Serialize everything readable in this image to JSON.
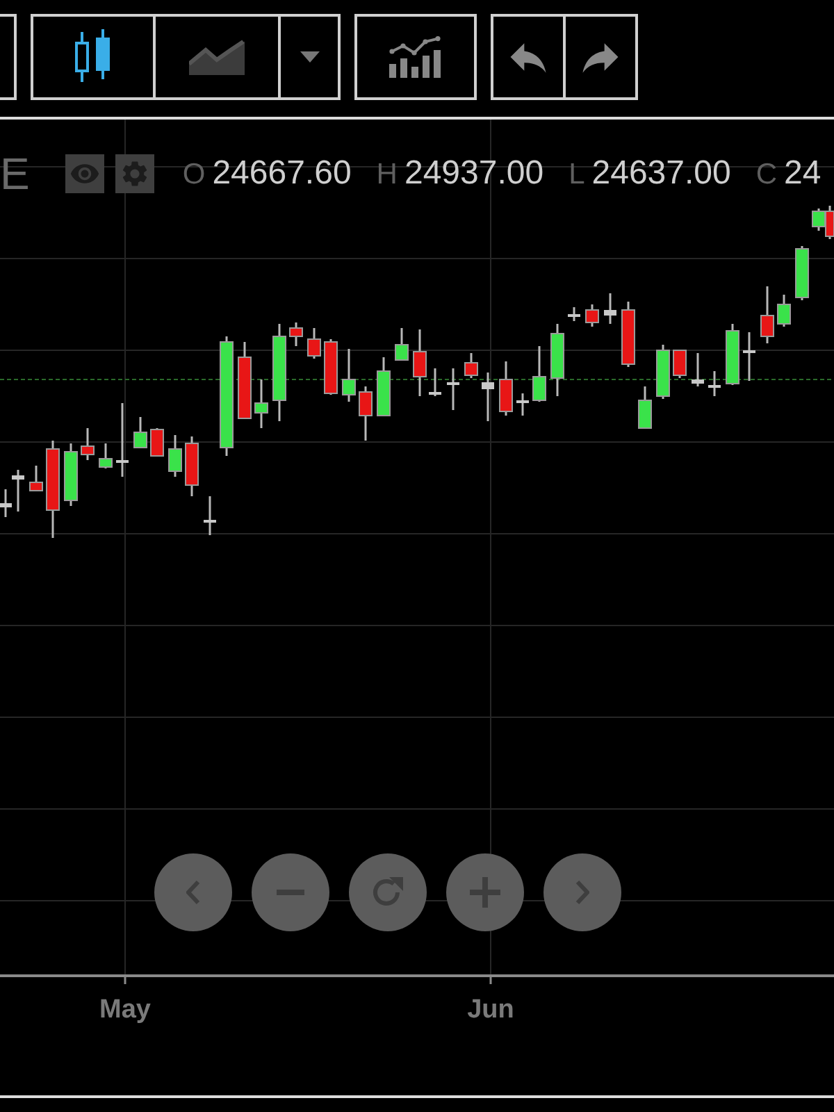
{
  "toolbar": {
    "chart_types": [
      {
        "kind": "candlestick",
        "selected": true
      },
      {
        "kind": "area",
        "selected": false
      }
    ]
  },
  "legend": {
    "symbol": "E",
    "fields": [
      {
        "label": "O",
        "value": "24667.60"
      },
      {
        "label": "H",
        "value": "24937.00"
      },
      {
        "label": "L",
        "value": "24637.00"
      },
      {
        "label": "C",
        "value": "24"
      }
    ]
  },
  "x_axis": {
    "labels": [
      "May",
      "Jun"
    ]
  }
}
